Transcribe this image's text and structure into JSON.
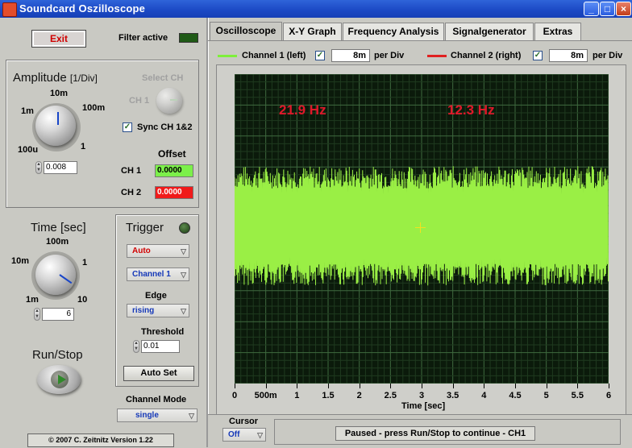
{
  "window": {
    "title": "Soundcard Oszilloscope"
  },
  "left": {
    "exit_label": "Exit",
    "filter_active_label": "Filter active",
    "amplitude": {
      "title": "Amplitude",
      "unit": "[1/Div]",
      "ticks": [
        "10m",
        "1m",
        "100m",
        "100u",
        "1"
      ],
      "value": "0.008"
    },
    "select_ch": {
      "label": "Select CH",
      "ch_label": "CH 1"
    },
    "sync_label": "Sync CH 1&2",
    "offset": {
      "title": "Offset",
      "ch1_label": "CH 1",
      "ch1_value": "0.0000",
      "ch2_label": "CH 2",
      "ch2_value": "0.0000"
    },
    "time": {
      "title": "Time [sec]",
      "ticks": [
        "100m",
        "10m",
        "1",
        "1m",
        "10"
      ],
      "value": "6"
    },
    "trigger": {
      "title": "Trigger",
      "mode": "Auto",
      "channel": "Channel 1",
      "edge_label": "Edge",
      "edge_value": "rising",
      "threshold_label": "Threshold",
      "threshold_value": "0.01",
      "autoset_label": "Auto Set"
    },
    "runstop_label": "Run/Stop",
    "channel_mode": {
      "label": "Channel Mode",
      "value": "single"
    },
    "copyright": "© 2007  C. Zeitnitz Version 1.22"
  },
  "tabs": [
    "Oscilloscope",
    "X-Y Graph",
    "Frequency Analysis",
    "Signalgenerator",
    "Extras"
  ],
  "channels": {
    "ch1": {
      "label": "Channel 1 (left)",
      "value": "8m",
      "per_div": "per Div",
      "color": "#7ef03a"
    },
    "ch2": {
      "label": "Channel 2 (right)",
      "value": "8m",
      "per_div": "per Div",
      "color": "#e02020"
    }
  },
  "scope": {
    "freq1": "21.9 Hz",
    "freq2": "12.3 Hz",
    "x_ticks": [
      "0",
      "500m",
      "1",
      "1.5",
      "2",
      "2.5",
      "3",
      "3.5",
      "4",
      "4.5",
      "5",
      "5.5",
      "6"
    ],
    "x_label": "Time [sec]",
    "signal_color": "#9aef45"
  },
  "bottom": {
    "cursor_label": "Cursor",
    "cursor_value": "Off",
    "status": "Paused - press Run/Stop to continue - CH1"
  }
}
